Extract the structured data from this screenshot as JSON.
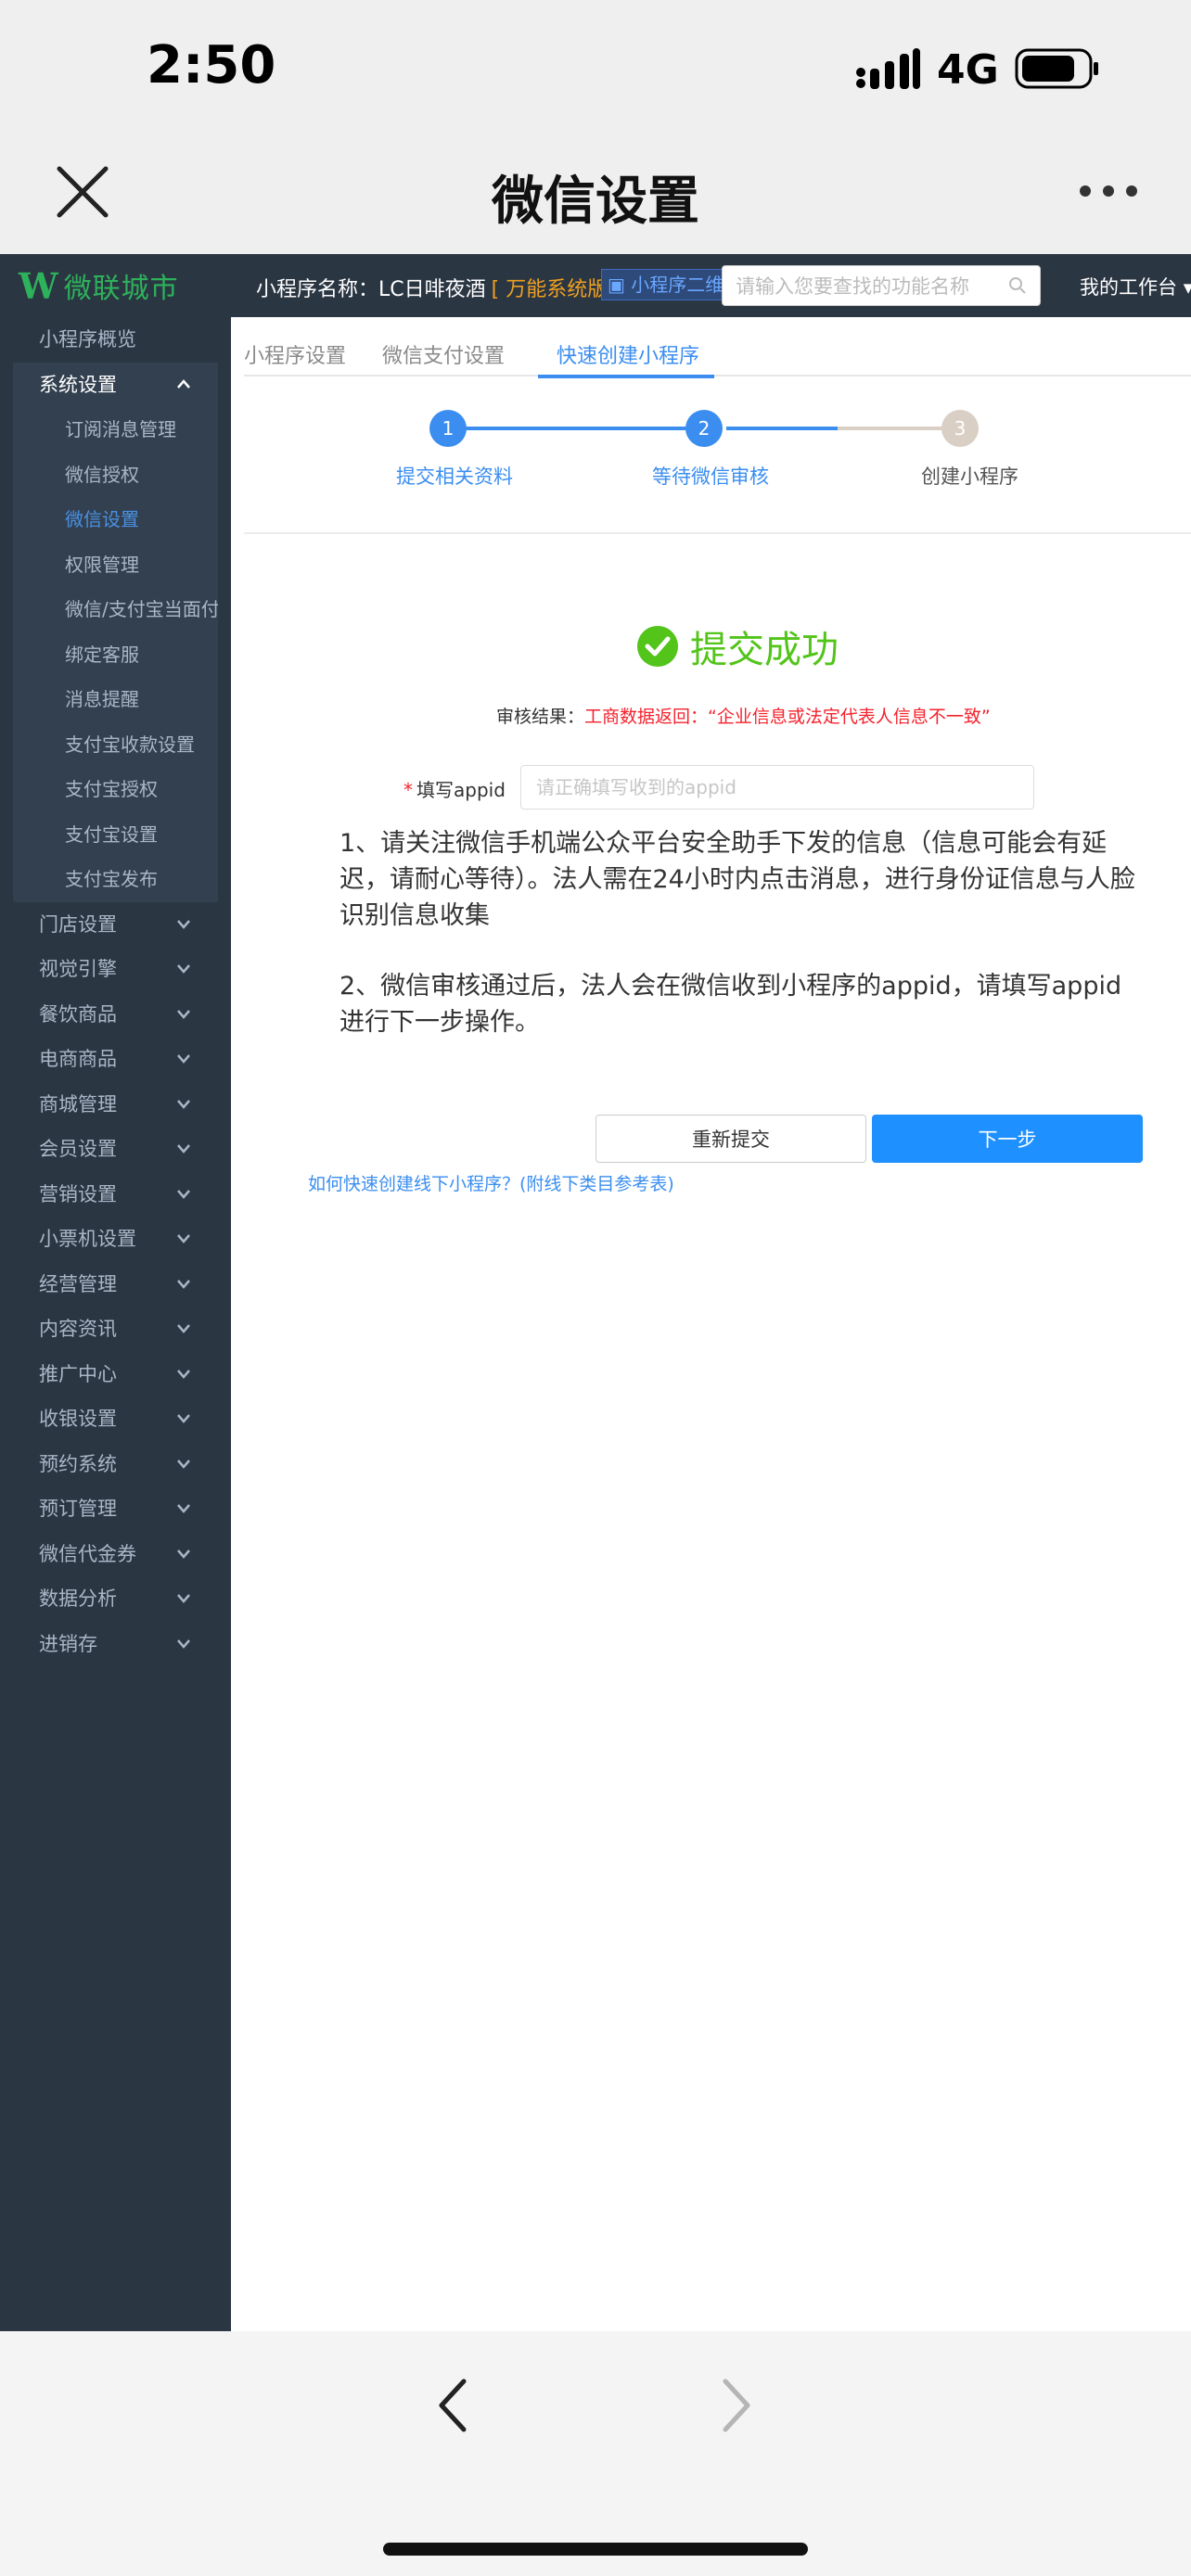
{
  "status": {
    "time": "2:50",
    "network": "4G"
  },
  "nav": {
    "title": "微信设置"
  },
  "topbar": {
    "logo_mark": "W",
    "logo_text": "微联城市",
    "mp_label": "小程序名称：",
    "mp_name": "LC日啡夜酒",
    "version": "[ 万能系统版 ]",
    "qr_label": "小程序二维码",
    "search_placeholder": "请输入您要查找的功能名称",
    "workbench": "我的工作台"
  },
  "sidebar": {
    "overview": "小程序概览",
    "system_settings": "系统设置",
    "sub_items": [
      "订阅消息管理",
      "微信授权",
      "微信设置",
      "权限管理",
      "微信/支付宝当面付",
      "绑定客服",
      "消息提醒",
      "支付宝收款设置",
      "支付宝授权",
      "支付宝设置",
      "支付宝发布"
    ],
    "active_sub": "微信设置",
    "items": [
      "门店设置",
      "视觉引擎",
      "餐饮商品",
      "电商商品",
      "商城管理",
      "会员设置",
      "营销设置",
      "小票机设置",
      "经营管理",
      "内容资讯",
      "推广中心",
      "收银设置",
      "预约系统",
      "预订管理",
      "微信代金券",
      "数据分析",
      "进销存"
    ]
  },
  "tabs": [
    "小程序设置",
    "微信支付设置",
    "快速创建小程序"
  ],
  "active_tab": "快速创建小程序",
  "steps": [
    {
      "num": "1",
      "label": "提交相关资料"
    },
    {
      "num": "2",
      "label": "等待微信审核"
    },
    {
      "num": "3",
      "label": "创建小程序"
    }
  ],
  "success_text": "提交成功",
  "result": {
    "label": "审核结果：",
    "message": "工商数据返回：“企业信息或法定代表人信息不一致”"
  },
  "appid": {
    "label": "填写appid",
    "placeholder": "请正确填写收到的appid",
    "value": ""
  },
  "notes": [
    "1、请关注微信手机端公众平台安全助手下发的信息（信息可能会有延迟，请耐心等待）。法人需在24小时内点击消息，进行身份证信息与人脸识别信息收集",
    "2、微信审核通过后，法人会在微信收到小程序的appid，请填写appid进行下一步操作。"
  ],
  "buttons": {
    "resubmit": "重新提交",
    "next": "下一步"
  },
  "help_link": "如何快速创建线下小程序？(附线下类目参考表)",
  "colors": {
    "primary": "#1e90ff",
    "success": "#52c41a",
    "error": "#f5222d",
    "sidebar": "#2b3643"
  }
}
